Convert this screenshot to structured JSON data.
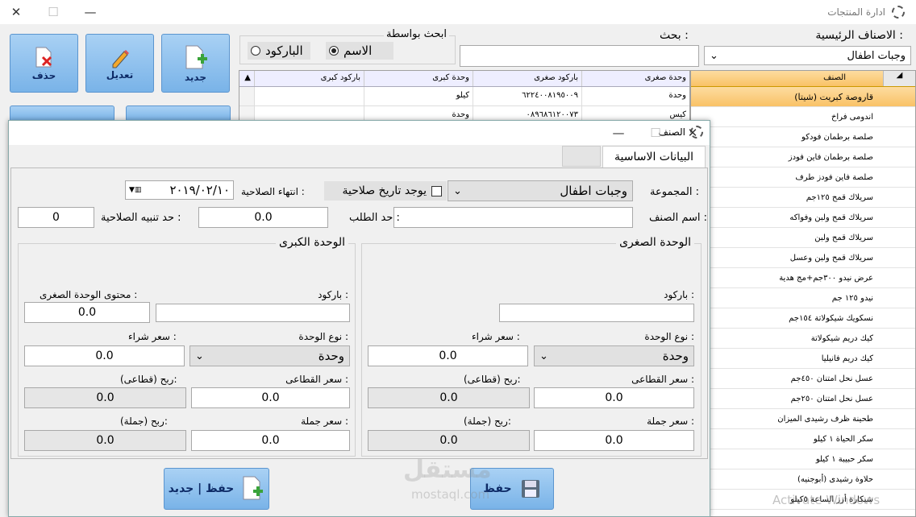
{
  "main_window": {
    "title": "ادارة المنتجات"
  },
  "actions": {
    "new_label": "جديد",
    "edit_label": "تعديل",
    "delete_label": "حذف"
  },
  "search": {
    "by_label": "ابحث بواسطة",
    "name_option": "الاسم",
    "barcode_option": "الباركود",
    "search_label": "بحث :",
    "search_value": ""
  },
  "categories": {
    "label": "الاصناف الرئيسية :",
    "selected": "وجبات اطفال"
  },
  "products_table": {
    "columns": [
      "باركود كبرى",
      "وحدة كبرى",
      "باركود صغرى",
      "وحدة صغرى"
    ],
    "rows": [
      {
        "big_barcode": "",
        "big_unit": "كيلو",
        "small_barcode": "٦٢٢٤٠٠٨١٩٥٠٠٩",
        "small_unit": "وحدة"
      },
      {
        "big_barcode": "",
        "big_unit": "وحدة",
        "small_barcode": "٠٨٩٦٨٦١٢٠٠٧٣",
        "small_unit": "كيس"
      }
    ]
  },
  "items_list": {
    "header": "الصنف",
    "selected_index": 0,
    "items": [
      "قاروصة كبريت (شيتا)",
      "اندومى فراخ",
      "صلصة برطمان فودكو",
      "صلصة برطمان فاين فودز",
      "صلصة فاين فودز طرف",
      "سريلاك قمح ١٢٥جم",
      "سريلاك قمح ولبن وفواكه",
      "سريلاك قمح ولبن",
      "سريلاك قمح ولبن وعسل",
      "عرض نيدو ٣٠٠جم+مج هدية",
      "نيدو ١٢٥ جم",
      "نسكويك شيكولاتة ١٥٤جم",
      "كيك دريم شيكولاتة",
      "كيك دريم فانيليا",
      "عسل نحل امتنان ٤٥٠جم",
      "عسل نحل امتنان ٢٥٠جم",
      "طحينة ظرف رشيدى الميزان",
      "سكر الحياة ١ كيلو",
      "سكر حبيبة ١ كيلو",
      "حلاوة رشيدى (أبوجنيه)",
      "شيكارة أرز الساعة ٥كيلو"
    ]
  },
  "dialog": {
    "title": "الصنف",
    "tab_label": "البيانات الاساسية",
    "group_label": "المجموعة :",
    "group_value": "وجبات اطفال",
    "has_expiry_label": "يوجد تاريخ صلاحية",
    "expiry_end_label": "انتهاء الصلاحية :",
    "expiry_date": "٢٠١٩/٠٢/١٠",
    "item_name_label": "اسم الصنف :",
    "item_name_value": "",
    "reorder_label": "حد الطلب :",
    "reorder_value": "0.0",
    "expiry_alert_label": "حد تنبيه الصلاحية :",
    "expiry_alert_value": "0",
    "small_unit": {
      "title": "الوحدة الصغرى",
      "barcode_label": "باركود :",
      "barcode": "",
      "unit_type_label": "نوع الوحدة :",
      "unit_type": "وحدة",
      "purchase_label": "سعر شراء :",
      "purchase": "0.0",
      "retail_label": "سعر القطاعى :",
      "retail": "0.0",
      "retail_profit_label": "ربح (قطاعى):",
      "retail_profit": "0.0",
      "wholesale_label": "سعر جملة :",
      "wholesale": "0.0",
      "wholesale_profit_label": "ربح (جملة):",
      "wholesale_profit": "0.0"
    },
    "big_unit": {
      "title": "الوحدة الكبرى",
      "barcode_label": "باركود :",
      "barcode": "",
      "content_label": "محتوى الوحدة الصغرى :",
      "content": "0.0",
      "unit_type_label": "نوع الوحدة :",
      "unit_type": "وحدة",
      "purchase_label": "سعر شراء :",
      "purchase": "0.0",
      "retail_label": "سعر القطاعى :",
      "retail": "0.0",
      "retail_profit_label": "ربح (قطاعى):",
      "retail_profit": "0.0",
      "wholesale_label": "سعر جملة :",
      "wholesale": "0.0",
      "wholesale_profit_label": "ربح (جملة):",
      "wholesale_profit": "0.0"
    },
    "save_label": "حفظ",
    "save_new_label": "حفظ | جديد"
  },
  "watermark": {
    "brand": "مستقل",
    "domain": "mostaql.com",
    "os_text": "Activate Windows"
  }
}
